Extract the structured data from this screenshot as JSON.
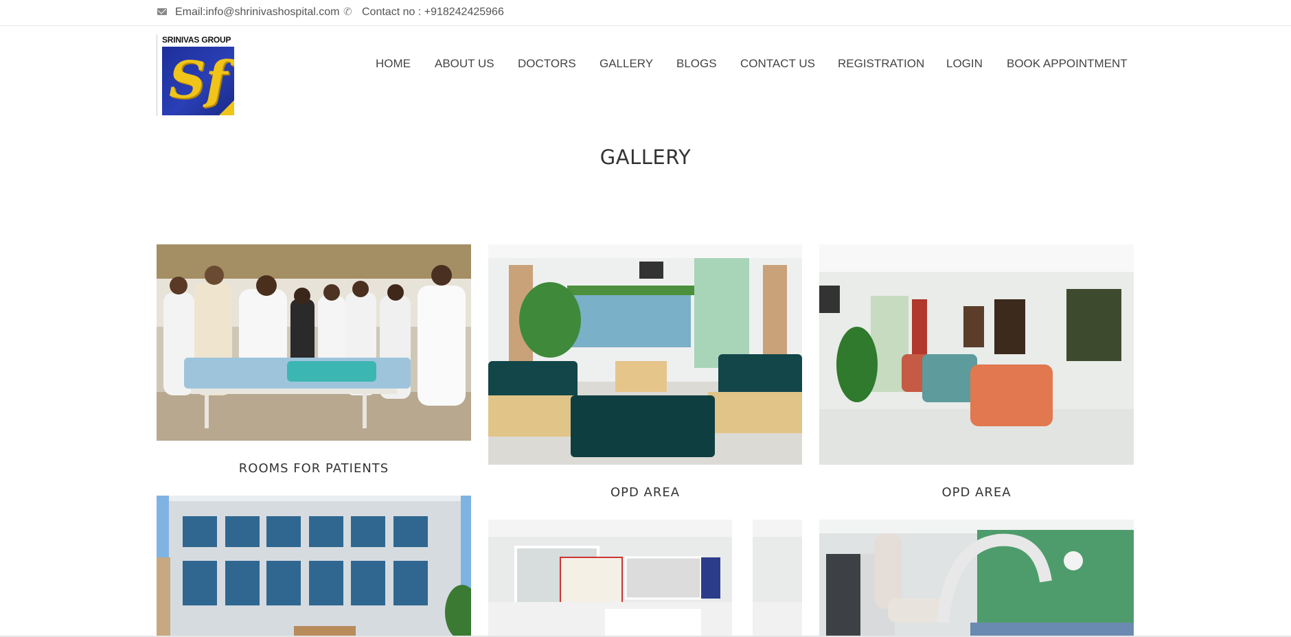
{
  "topbar": {
    "email": "Email:info@shrinivashospital.com",
    "contact": "Contact no : +918242425966",
    "email_icon": "envelope-icon",
    "phone_icon": "phone-icon"
  },
  "logo": {
    "brand_text": "SRINIVAS GROUP",
    "glyph": "Sf"
  },
  "nav": {
    "items": [
      {
        "label": "HOME"
      },
      {
        "label": "ABOUT US"
      },
      {
        "label": "DOCTORS"
      },
      {
        "label": "GALLERY"
      },
      {
        "label": "BLOGS"
      },
      {
        "label": "CONTACT US"
      },
      {
        "label": "REGISTRATION"
      },
      {
        "label": "LOGIN"
      },
      {
        "label": "BOOK APPOINTMENT"
      }
    ]
  },
  "page": {
    "title": "GALLERY"
  },
  "gallery": {
    "items": [
      {
        "caption": "ROOMS FOR PATIENTS",
        "image": "doctors-at-bedside-photo"
      },
      {
        "caption": "OPD AREA",
        "image": "day-care-lounge-photo"
      },
      {
        "caption": "OPD AREA",
        "image": "waiting-chairs-photo"
      },
      {
        "caption": "",
        "image": "hospital-building-photo"
      },
      {
        "caption": "",
        "image": "reception-desk-photo"
      },
      {
        "caption": "",
        "image": "cath-lab-photo"
      }
    ]
  },
  "colors": {
    "nav_text": "#444444",
    "logo_blue": "#1d2f9a",
    "logo_gold": "#f0c419"
  }
}
